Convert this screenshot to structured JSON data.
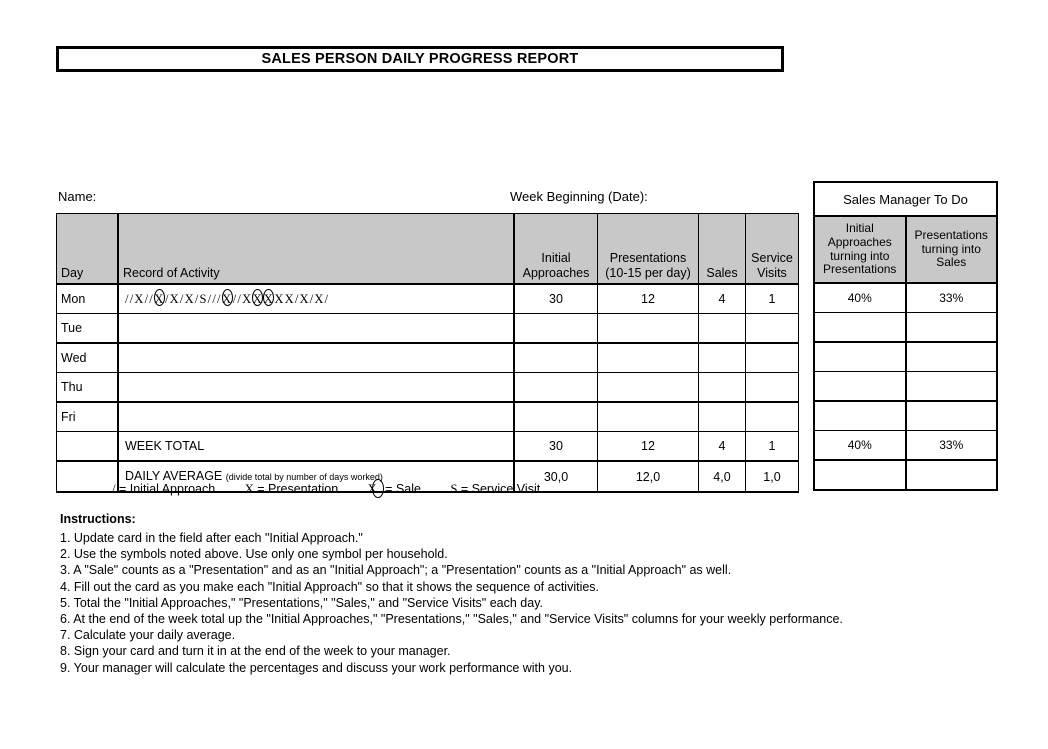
{
  "document": {
    "title": "SALES PERSON DAILY PROGRESS REPORT"
  },
  "meta": {
    "name_label": "Name:",
    "week_label": "Week Beginning (Date):"
  },
  "main_table": {
    "headers": {
      "day": "Day",
      "record": "Record of Activity",
      "initial_approaches": "Initial\nApproaches",
      "initial_approaches_line1": "Initial",
      "initial_approaches_line2": "Approaches",
      "presentations_line1": "Presentations",
      "presentations_line2": "(10-15 per day)",
      "sales": "Sales",
      "service_line1": "Service",
      "service_line2": "Visits"
    },
    "rows": [
      {
        "day": "Mon",
        "activity": "//X//X/X/X/S///X//XXXXX/X/X/",
        "initial_approaches": "30",
        "presentations": "12",
        "sales": "4",
        "service_visits": "1"
      },
      {
        "day": "Tue",
        "activity": "",
        "initial_approaches": "",
        "presentations": "",
        "sales": "",
        "service_visits": ""
      },
      {
        "day": "Wed",
        "activity": "",
        "initial_approaches": "",
        "presentations": "",
        "sales": "",
        "service_visits": ""
      },
      {
        "day": "Thu",
        "activity": "",
        "initial_approaches": "",
        "presentations": "",
        "sales": "",
        "service_visits": ""
      },
      {
        "day": "Fri",
        "activity": "",
        "initial_approaches": "",
        "presentations": "",
        "sales": "",
        "service_visits": ""
      }
    ],
    "week_total": {
      "day": "",
      "label": "WEEK TOTAL",
      "initial_approaches": "30",
      "presentations": "12",
      "sales": "4",
      "service_visits": "1"
    },
    "daily_average": {
      "day": "",
      "label": "DAILY AVERAGE",
      "note": "(divide total by number of days worked)",
      "initial_approaches": "30,0",
      "presentations": "12,0",
      "sales": "4,0",
      "service_visits": "1,0"
    }
  },
  "manager_table": {
    "title": "Sales Manager To Do",
    "headers": {
      "col1_line1": "Initial",
      "col1_line2": "Approaches",
      "col1_line3": "turning into",
      "col1_line4": "Presentations",
      "col2_line1": "Presentations",
      "col2_line2": "turning into",
      "col2_line3": "Sales"
    },
    "rows": [
      {
        "approaches_to_presentations": "40%",
        "presentations_to_sales": "33%"
      },
      {
        "approaches_to_presentations": "",
        "presentations_to_sales": ""
      },
      {
        "approaches_to_presentations": "",
        "presentations_to_sales": ""
      },
      {
        "approaches_to_presentations": "",
        "presentations_to_sales": ""
      },
      {
        "approaches_to_presentations": "",
        "presentations_to_sales": ""
      },
      {
        "approaches_to_presentations": "40%",
        "presentations_to_sales": "33%"
      },
      {
        "approaches_to_presentations": "",
        "presentations_to_sales": ""
      }
    ]
  },
  "legend": {
    "items": [
      {
        "symbol": "/",
        "text": "= Initial Approach"
      },
      {
        "symbol": "X",
        "text": "= Presentation"
      },
      {
        "symbol": "X",
        "circled": true,
        "text": "= Sale"
      },
      {
        "symbol": "S",
        "text": "= Service Visit"
      }
    ]
  },
  "instructions": {
    "heading": "Instructions:",
    "items": [
      "1. Update card in the field after each \"Initial Approach.\"",
      "2. Use the symbols noted above. Use only one symbol per household.",
      "3. A \"Sale\" counts as a \"Presentation\" and as an \"Initial Approach\"; a \"Presentation\" counts as a \"Initial Approach\" as well.",
      "4. Fill out the card as you make each \"Initial Approach\" so that it shows the sequence of activities.",
      "5. Total the \"Initial Approaches,\" \"Presentations,\" \"Sales,\" and \"Service Visits\" each day.",
      "6. At the end of the week total up the \"Initial Approaches,\" \"Presentations,\" \"Sales,\" and \"Service Visits\" columns for your weekly performance.",
      "7. Calculate your daily average.",
      "8. Sign your card and turn it in at the end of the week to your manager.",
      "9. Your manager will calculate the percentages and discuss your work performance with you."
    ]
  },
  "colors": {
    "header_gray": "#c8c8c8",
    "border": "#000000",
    "background": "#ffffff"
  }
}
